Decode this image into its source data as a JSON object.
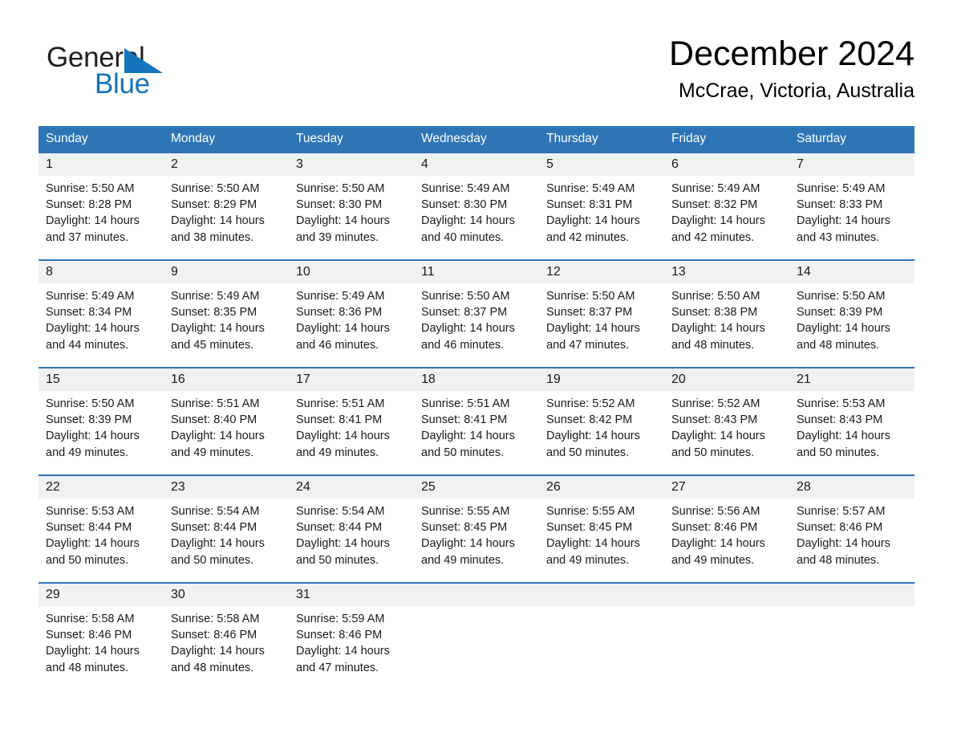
{
  "brand": {
    "name_part1": "General",
    "name_part2": "Blue",
    "triangle_color": "#1574bb",
    "text_color": "#231f20"
  },
  "header": {
    "title": "December 2024",
    "location": "McCrae, Victoria, Australia"
  },
  "theme": {
    "header_blue": "#2e75b6",
    "daynum_band": "#f1f1f1",
    "page_background": "#ffffff"
  },
  "calendar": {
    "weekday_headers": [
      "Sunday",
      "Monday",
      "Tuesday",
      "Wednesday",
      "Thursday",
      "Friday",
      "Saturday"
    ],
    "weeks": [
      {
        "days": [
          {
            "num": "1",
            "sunrise": "Sunrise: 5:50 AM",
            "sunset": "Sunset: 8:28 PM",
            "daylight": "Daylight: 14 hours and 37 minutes."
          },
          {
            "num": "2",
            "sunrise": "Sunrise: 5:50 AM",
            "sunset": "Sunset: 8:29 PM",
            "daylight": "Daylight: 14 hours and 38 minutes."
          },
          {
            "num": "3",
            "sunrise": "Sunrise: 5:50 AM",
            "sunset": "Sunset: 8:30 PM",
            "daylight": "Daylight: 14 hours and 39 minutes."
          },
          {
            "num": "4",
            "sunrise": "Sunrise: 5:49 AM",
            "sunset": "Sunset: 8:30 PM",
            "daylight": "Daylight: 14 hours and 40 minutes."
          },
          {
            "num": "5",
            "sunrise": "Sunrise: 5:49 AM",
            "sunset": "Sunset: 8:31 PM",
            "daylight": "Daylight: 14 hours and 42 minutes."
          },
          {
            "num": "6",
            "sunrise": "Sunrise: 5:49 AM",
            "sunset": "Sunset: 8:32 PM",
            "daylight": "Daylight: 14 hours and 42 minutes."
          },
          {
            "num": "7",
            "sunrise": "Sunrise: 5:49 AM",
            "sunset": "Sunset: 8:33 PM",
            "daylight": "Daylight: 14 hours and 43 minutes."
          }
        ]
      },
      {
        "days": [
          {
            "num": "8",
            "sunrise": "Sunrise: 5:49 AM",
            "sunset": "Sunset: 8:34 PM",
            "daylight": "Daylight: 14 hours and 44 minutes."
          },
          {
            "num": "9",
            "sunrise": "Sunrise: 5:49 AM",
            "sunset": "Sunset: 8:35 PM",
            "daylight": "Daylight: 14 hours and 45 minutes."
          },
          {
            "num": "10",
            "sunrise": "Sunrise: 5:49 AM",
            "sunset": "Sunset: 8:36 PM",
            "daylight": "Daylight: 14 hours and 46 minutes."
          },
          {
            "num": "11",
            "sunrise": "Sunrise: 5:50 AM",
            "sunset": "Sunset: 8:37 PM",
            "daylight": "Daylight: 14 hours and 46 minutes."
          },
          {
            "num": "12",
            "sunrise": "Sunrise: 5:50 AM",
            "sunset": "Sunset: 8:37 PM",
            "daylight": "Daylight: 14 hours and 47 minutes."
          },
          {
            "num": "13",
            "sunrise": "Sunrise: 5:50 AM",
            "sunset": "Sunset: 8:38 PM",
            "daylight": "Daylight: 14 hours and 48 minutes."
          },
          {
            "num": "14",
            "sunrise": "Sunrise: 5:50 AM",
            "sunset": "Sunset: 8:39 PM",
            "daylight": "Daylight: 14 hours and 48 minutes."
          }
        ]
      },
      {
        "days": [
          {
            "num": "15",
            "sunrise": "Sunrise: 5:50 AM",
            "sunset": "Sunset: 8:39 PM",
            "daylight": "Daylight: 14 hours and 49 minutes."
          },
          {
            "num": "16",
            "sunrise": "Sunrise: 5:51 AM",
            "sunset": "Sunset: 8:40 PM",
            "daylight": "Daylight: 14 hours and 49 minutes."
          },
          {
            "num": "17",
            "sunrise": "Sunrise: 5:51 AM",
            "sunset": "Sunset: 8:41 PM",
            "daylight": "Daylight: 14 hours and 49 minutes."
          },
          {
            "num": "18",
            "sunrise": "Sunrise: 5:51 AM",
            "sunset": "Sunset: 8:41 PM",
            "daylight": "Daylight: 14 hours and 50 minutes."
          },
          {
            "num": "19",
            "sunrise": "Sunrise: 5:52 AM",
            "sunset": "Sunset: 8:42 PM",
            "daylight": "Daylight: 14 hours and 50 minutes."
          },
          {
            "num": "20",
            "sunrise": "Sunrise: 5:52 AM",
            "sunset": "Sunset: 8:43 PM",
            "daylight": "Daylight: 14 hours and 50 minutes."
          },
          {
            "num": "21",
            "sunrise": "Sunrise: 5:53 AM",
            "sunset": "Sunset: 8:43 PM",
            "daylight": "Daylight: 14 hours and 50 minutes."
          }
        ]
      },
      {
        "days": [
          {
            "num": "22",
            "sunrise": "Sunrise: 5:53 AM",
            "sunset": "Sunset: 8:44 PM",
            "daylight": "Daylight: 14 hours and 50 minutes."
          },
          {
            "num": "23",
            "sunrise": "Sunrise: 5:54 AM",
            "sunset": "Sunset: 8:44 PM",
            "daylight": "Daylight: 14 hours and 50 minutes."
          },
          {
            "num": "24",
            "sunrise": "Sunrise: 5:54 AM",
            "sunset": "Sunset: 8:44 PM",
            "daylight": "Daylight: 14 hours and 50 minutes."
          },
          {
            "num": "25",
            "sunrise": "Sunrise: 5:55 AM",
            "sunset": "Sunset: 8:45 PM",
            "daylight": "Daylight: 14 hours and 49 minutes."
          },
          {
            "num": "26",
            "sunrise": "Sunrise: 5:55 AM",
            "sunset": "Sunset: 8:45 PM",
            "daylight": "Daylight: 14 hours and 49 minutes."
          },
          {
            "num": "27",
            "sunrise": "Sunrise: 5:56 AM",
            "sunset": "Sunset: 8:46 PM",
            "daylight": "Daylight: 14 hours and 49 minutes."
          },
          {
            "num": "28",
            "sunrise": "Sunrise: 5:57 AM",
            "sunset": "Sunset: 8:46 PM",
            "daylight": "Daylight: 14 hours and 48 minutes."
          }
        ]
      },
      {
        "days": [
          {
            "num": "29",
            "sunrise": "Sunrise: 5:58 AM",
            "sunset": "Sunset: 8:46 PM",
            "daylight": "Daylight: 14 hours and 48 minutes."
          },
          {
            "num": "30",
            "sunrise": "Sunrise: 5:58 AM",
            "sunset": "Sunset: 8:46 PM",
            "daylight": "Daylight: 14 hours and 48 minutes."
          },
          {
            "num": "31",
            "sunrise": "Sunrise: 5:59 AM",
            "sunset": "Sunset: 8:46 PM",
            "daylight": "Daylight: 14 hours and 47 minutes."
          },
          {
            "num": "",
            "sunrise": "",
            "sunset": "",
            "daylight": ""
          },
          {
            "num": "",
            "sunrise": "",
            "sunset": "",
            "daylight": ""
          },
          {
            "num": "",
            "sunrise": "",
            "sunset": "",
            "daylight": ""
          },
          {
            "num": "",
            "sunrise": "",
            "sunset": "",
            "daylight": ""
          }
        ]
      }
    ]
  }
}
